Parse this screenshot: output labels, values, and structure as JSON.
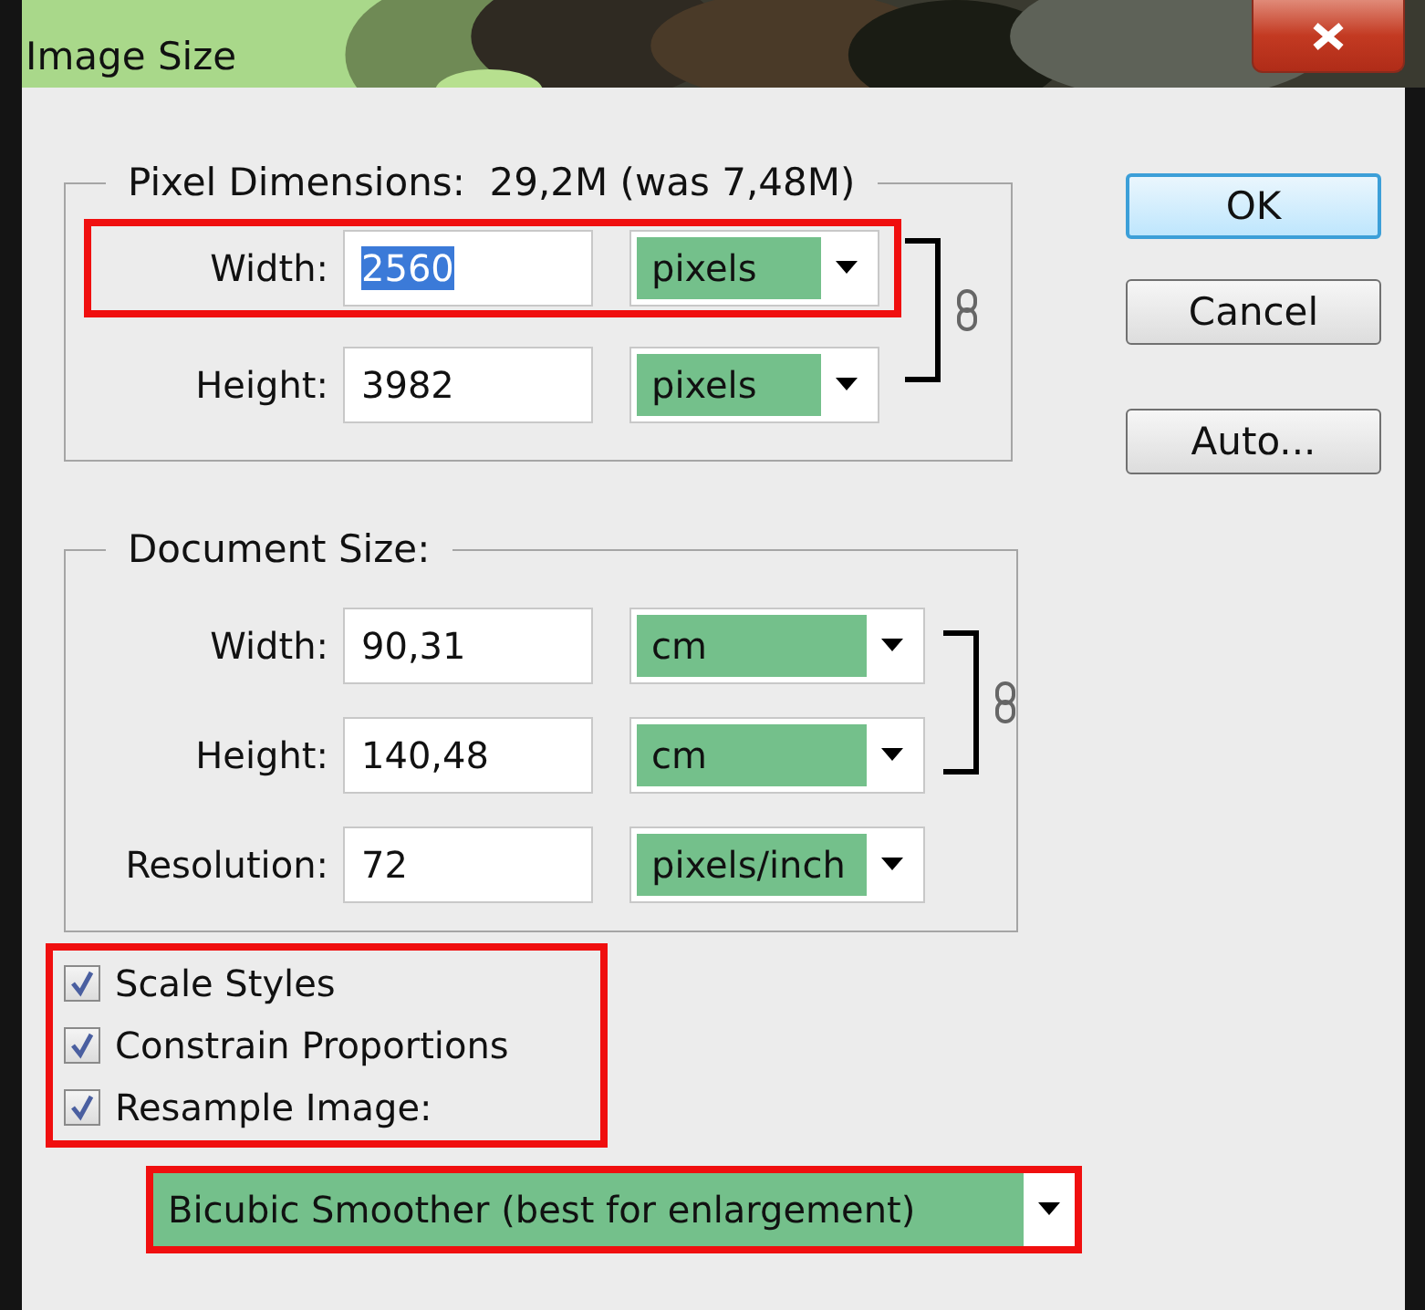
{
  "window": {
    "title": "Image Size"
  },
  "pixel_dimensions": {
    "label": "Pixel Dimensions:",
    "size": "29,2M (was 7,48M)",
    "linked": true,
    "rows": [
      {
        "label": "Width:",
        "value": "2560",
        "selected": true,
        "unit": "pixels",
        "highlighted": true
      },
      {
        "label": "Height:",
        "value": "3982",
        "selected": false,
        "unit": "pixels",
        "highlighted": false
      }
    ]
  },
  "document_size": {
    "label": "Document Size:",
    "linked": true,
    "rows": [
      {
        "label": "Width:",
        "value": "90,31",
        "unit": "cm"
      },
      {
        "label": "Height:",
        "value": "140,48",
        "unit": "cm"
      },
      {
        "label": "Resolution:",
        "value": "72",
        "unit": "pixels/inch"
      }
    ]
  },
  "options": {
    "highlighted": true,
    "items": [
      {
        "label": "Scale Styles",
        "checked": true
      },
      {
        "label": "Constrain Proportions",
        "checked": true
      },
      {
        "label": "Resample Image:",
        "checked": true
      }
    ]
  },
  "resample": {
    "value": "Bicubic Smoother (best for enlargement)",
    "highlighted": true
  },
  "buttons": [
    {
      "label": "OK",
      "default": true
    },
    {
      "label": "Cancel",
      "default": false
    },
    {
      "label": "Auto...",
      "default": false
    }
  ]
}
